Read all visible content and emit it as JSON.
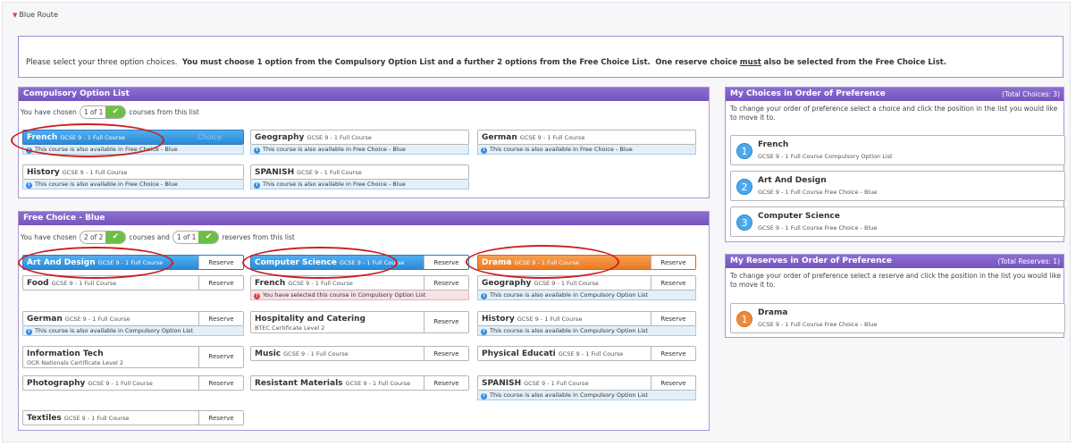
{
  "route_label": "Blue Route",
  "instructions": {
    "part1": "Please select your three option choices.",
    "part2": "You must choose 1 option from the Compulsory Option List and a further 2 options from the Free Choice List.",
    "part3": "One reserve choice",
    "must": "must",
    "part4": "also be selected from the Free Choice List."
  },
  "compulsory": {
    "title": "Compulsory Option List",
    "chosen_prefix": "You have chosen",
    "chosen_count": "1 of 1",
    "chosen_suffix": "courses from this list",
    "choice_watermark": "Choice",
    "courses": [
      {
        "name": "French",
        "sub": "GCSE 9 - 1 Full Course",
        "note": "This course is also available in Free Choice - Blue"
      },
      {
        "name": "Geography",
        "sub": "GCSE 9 - 1 Full Course",
        "note": "This course is also available in Free Choice - Blue"
      },
      {
        "name": "German",
        "sub": "GCSE 9 - 1 Full Course",
        "note": "This course is also available in Free Choice - Blue"
      },
      {
        "name": "History",
        "sub": "GCSE 9 - 1 Full Course",
        "note": "This course is also available in Free Choice - Blue"
      },
      {
        "name": "SPANISH",
        "sub": "GCSE 9 - 1 Full Course",
        "note": "This course is also available in Free Choice - Blue"
      }
    ]
  },
  "free": {
    "title": "Free Choice - Blue",
    "chosen_prefix": "You have chosen",
    "chosen_count": "2 of 2",
    "mid": "courses and",
    "reserve_count": "1 of 1",
    "reserve_suffix": "reserves from this list",
    "reserve_label": "Reserve",
    "courses": [
      {
        "name": "Art And Design",
        "sub": "GCSE 9 - 1 Full Course"
      },
      {
        "name": "Computer Science",
        "sub": "GCSE 9 - 1 Full Course"
      },
      {
        "name": "Drama",
        "sub": "GCSE 9 - 1 Full Course"
      },
      {
        "name": "Food",
        "sub": "GCSE 9 - 1 Full Course"
      },
      {
        "name": "French",
        "sub": "GCSE 9 - 1 Full Course",
        "note": "You have selected this course in Compulsory Option List"
      },
      {
        "name": "Geography",
        "sub": "GCSE 9 - 1 Full Course",
        "note": "This course is also available in Compulsory Option List"
      },
      {
        "name": "German",
        "sub": "GCSE 9 - 1 Full Course",
        "note": "This course is also available in Compulsory Option List"
      },
      {
        "name": "Hospitality and Catering",
        "sub": "BTEC Certificate Level 2"
      },
      {
        "name": "History",
        "sub": "GCSE 9 - 1 Full Course",
        "note": "This course is also available in Compulsory Option List"
      },
      {
        "name": "Information Tech",
        "sub": "OCR Nationals Certificate Level 2"
      },
      {
        "name": "Music",
        "sub": "GCSE 9 - 1 Full Course"
      },
      {
        "name": "Physical Educati",
        "sub": "GCSE 9 - 1 Full Course"
      },
      {
        "name": "Photography",
        "sub": "GCSE 9 - 1 Full Course"
      },
      {
        "name": "Resistant Materials",
        "sub": "GCSE 9 - 1 Full Course"
      },
      {
        "name": "SPANISH",
        "sub": "GCSE 9 - 1 Full Course",
        "note": "This course is also available in Compulsory Option List"
      },
      {
        "name": "Textiles",
        "sub": "GCSE 9 - 1 Full Course"
      }
    ]
  },
  "choices": {
    "title": "My Choices in Order of Preference",
    "total": "(Total Choices: 3)",
    "desc": "To change your order of preference select a choice and click the position in the list you would like to move it to.",
    "items": [
      {
        "num": "1",
        "name": "French",
        "sub": "GCSE 9 - 1 Full Course Compulsory Option List"
      },
      {
        "num": "2",
        "name": "Art And Design",
        "sub": "GCSE 9 - 1 Full Course Free Choice - Blue"
      },
      {
        "num": "3",
        "name": "Computer Science",
        "sub": "GCSE 9 - 1 Full Course Free Choice - Blue"
      }
    ]
  },
  "reserves": {
    "title": "My Reserves in Order of Preference",
    "total": "(Total Reserves: 1)",
    "desc": "To change your order of preference select a reserve and click the position in the list you would like to move it to.",
    "items": [
      {
        "num": "1",
        "name": "Drama",
        "sub": "GCSE 9 - 1 Full Course Free Choice - Blue"
      }
    ]
  },
  "colors": {
    "header": "#7653bf",
    "selected_blue": "#2b8ad8",
    "reserve_orange": "#ea7a22",
    "check_green": "#6cbf46",
    "annotation_red": "#cc1f1f"
  }
}
